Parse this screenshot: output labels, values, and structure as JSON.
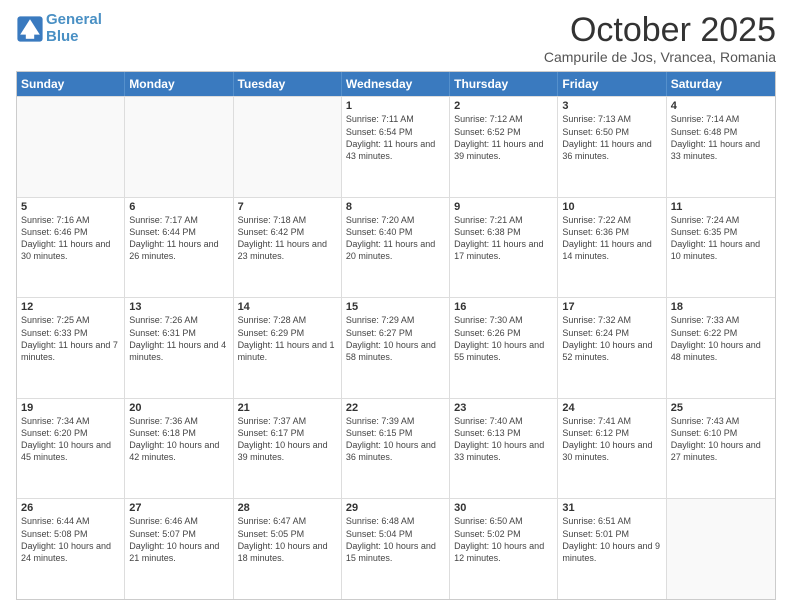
{
  "header": {
    "logo_line1": "General",
    "logo_line2": "Blue",
    "month": "October 2025",
    "location": "Campurile de Jos, Vrancea, Romania"
  },
  "days_of_week": [
    "Sunday",
    "Monday",
    "Tuesday",
    "Wednesday",
    "Thursday",
    "Friday",
    "Saturday"
  ],
  "weeks": [
    [
      {
        "day": null,
        "text": ""
      },
      {
        "day": null,
        "text": ""
      },
      {
        "day": null,
        "text": ""
      },
      {
        "day": "1",
        "text": "Sunrise: 7:11 AM\nSunset: 6:54 PM\nDaylight: 11 hours and 43 minutes."
      },
      {
        "day": "2",
        "text": "Sunrise: 7:12 AM\nSunset: 6:52 PM\nDaylight: 11 hours and 39 minutes."
      },
      {
        "day": "3",
        "text": "Sunrise: 7:13 AM\nSunset: 6:50 PM\nDaylight: 11 hours and 36 minutes."
      },
      {
        "day": "4",
        "text": "Sunrise: 7:14 AM\nSunset: 6:48 PM\nDaylight: 11 hours and 33 minutes."
      }
    ],
    [
      {
        "day": "5",
        "text": "Sunrise: 7:16 AM\nSunset: 6:46 PM\nDaylight: 11 hours and 30 minutes."
      },
      {
        "day": "6",
        "text": "Sunrise: 7:17 AM\nSunset: 6:44 PM\nDaylight: 11 hours and 26 minutes."
      },
      {
        "day": "7",
        "text": "Sunrise: 7:18 AM\nSunset: 6:42 PM\nDaylight: 11 hours and 23 minutes."
      },
      {
        "day": "8",
        "text": "Sunrise: 7:20 AM\nSunset: 6:40 PM\nDaylight: 11 hours and 20 minutes."
      },
      {
        "day": "9",
        "text": "Sunrise: 7:21 AM\nSunset: 6:38 PM\nDaylight: 11 hours and 17 minutes."
      },
      {
        "day": "10",
        "text": "Sunrise: 7:22 AM\nSunset: 6:36 PM\nDaylight: 11 hours and 14 minutes."
      },
      {
        "day": "11",
        "text": "Sunrise: 7:24 AM\nSunset: 6:35 PM\nDaylight: 11 hours and 10 minutes."
      }
    ],
    [
      {
        "day": "12",
        "text": "Sunrise: 7:25 AM\nSunset: 6:33 PM\nDaylight: 11 hours and 7 minutes."
      },
      {
        "day": "13",
        "text": "Sunrise: 7:26 AM\nSunset: 6:31 PM\nDaylight: 11 hours and 4 minutes."
      },
      {
        "day": "14",
        "text": "Sunrise: 7:28 AM\nSunset: 6:29 PM\nDaylight: 11 hours and 1 minute."
      },
      {
        "day": "15",
        "text": "Sunrise: 7:29 AM\nSunset: 6:27 PM\nDaylight: 10 hours and 58 minutes."
      },
      {
        "day": "16",
        "text": "Sunrise: 7:30 AM\nSunset: 6:26 PM\nDaylight: 10 hours and 55 minutes."
      },
      {
        "day": "17",
        "text": "Sunrise: 7:32 AM\nSunset: 6:24 PM\nDaylight: 10 hours and 52 minutes."
      },
      {
        "day": "18",
        "text": "Sunrise: 7:33 AM\nSunset: 6:22 PM\nDaylight: 10 hours and 48 minutes."
      }
    ],
    [
      {
        "day": "19",
        "text": "Sunrise: 7:34 AM\nSunset: 6:20 PM\nDaylight: 10 hours and 45 minutes."
      },
      {
        "day": "20",
        "text": "Sunrise: 7:36 AM\nSunset: 6:18 PM\nDaylight: 10 hours and 42 minutes."
      },
      {
        "day": "21",
        "text": "Sunrise: 7:37 AM\nSunset: 6:17 PM\nDaylight: 10 hours and 39 minutes."
      },
      {
        "day": "22",
        "text": "Sunrise: 7:39 AM\nSunset: 6:15 PM\nDaylight: 10 hours and 36 minutes."
      },
      {
        "day": "23",
        "text": "Sunrise: 7:40 AM\nSunset: 6:13 PM\nDaylight: 10 hours and 33 minutes."
      },
      {
        "day": "24",
        "text": "Sunrise: 7:41 AM\nSunset: 6:12 PM\nDaylight: 10 hours and 30 minutes."
      },
      {
        "day": "25",
        "text": "Sunrise: 7:43 AM\nSunset: 6:10 PM\nDaylight: 10 hours and 27 minutes."
      }
    ],
    [
      {
        "day": "26",
        "text": "Sunrise: 6:44 AM\nSunset: 5:08 PM\nDaylight: 10 hours and 24 minutes."
      },
      {
        "day": "27",
        "text": "Sunrise: 6:46 AM\nSunset: 5:07 PM\nDaylight: 10 hours and 21 minutes."
      },
      {
        "day": "28",
        "text": "Sunrise: 6:47 AM\nSunset: 5:05 PM\nDaylight: 10 hours and 18 minutes."
      },
      {
        "day": "29",
        "text": "Sunrise: 6:48 AM\nSunset: 5:04 PM\nDaylight: 10 hours and 15 minutes."
      },
      {
        "day": "30",
        "text": "Sunrise: 6:50 AM\nSunset: 5:02 PM\nDaylight: 10 hours and 12 minutes."
      },
      {
        "day": "31",
        "text": "Sunrise: 6:51 AM\nSunset: 5:01 PM\nDaylight: 10 hours and 9 minutes."
      },
      {
        "day": null,
        "text": ""
      }
    ]
  ]
}
